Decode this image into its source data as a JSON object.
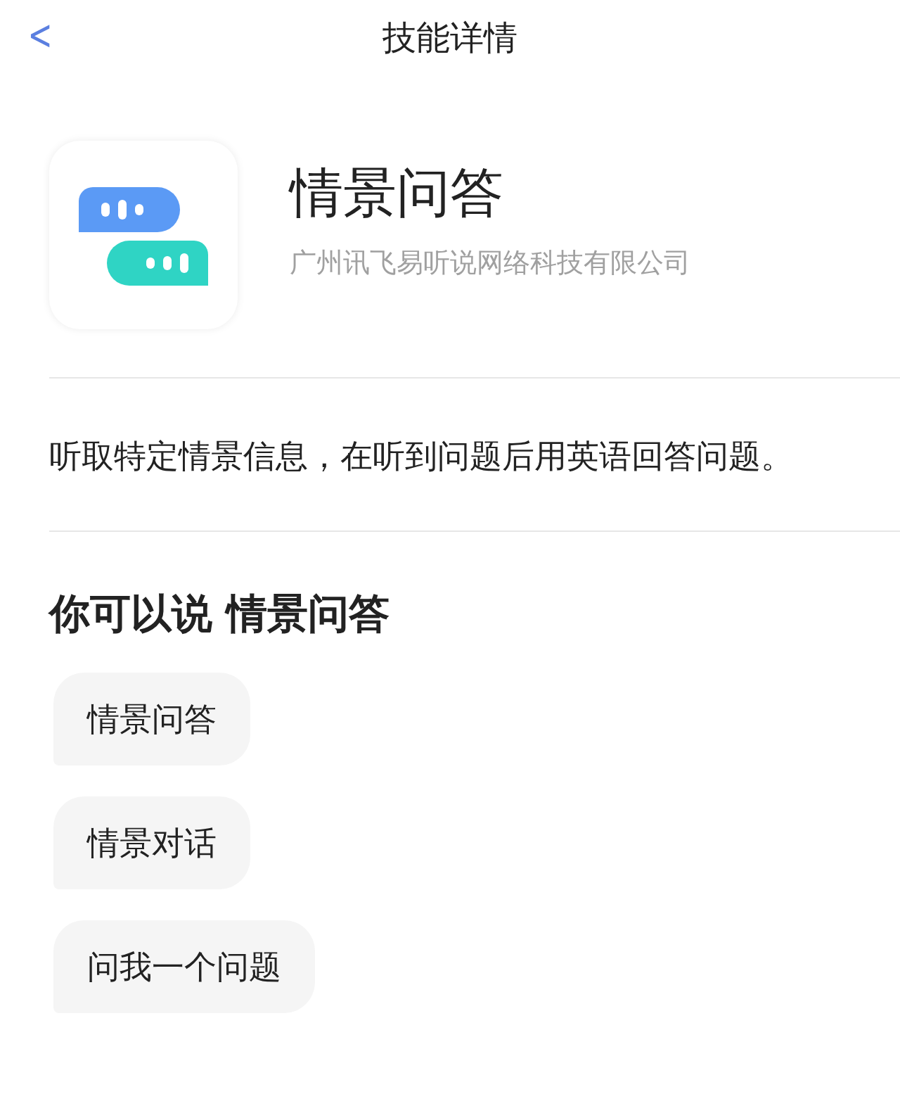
{
  "nav": {
    "back": "<",
    "title": "技能详情"
  },
  "skill": {
    "name": "情景问答",
    "company": "广州讯飞易听说网络科技有限公司"
  },
  "description": "听取特定情景信息，在听到问题后用英语回答问题。",
  "examples": {
    "heading": "你可以说 情景问答",
    "items": [
      "情景问答",
      "情景对话",
      "问我一个问题"
    ]
  }
}
